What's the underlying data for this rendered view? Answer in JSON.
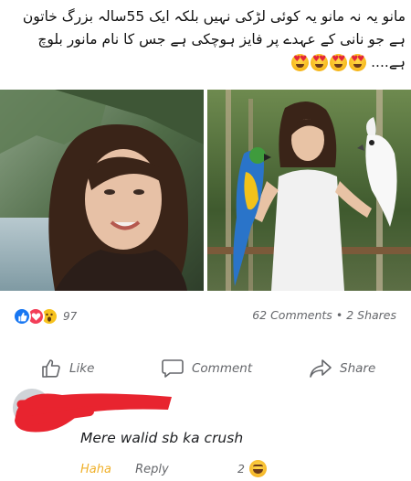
{
  "post": {
    "text_lines": [
      "مانو یہ نہ مانو یہ کوئی لڑکی نہیں بلکہ ایک 55سالہ بزرگ خاتون",
      "ہے جو نانی کے عہدے پر فایز ہوچکی ہے جس کا نام مانور بلوچ",
      "ہے...."
    ],
    "emojis": [
      "heart-eyes",
      "heart-eyes",
      "heart-eyes",
      "heart-eyes"
    ]
  },
  "reactions": {
    "types": [
      "like",
      "love",
      "wow"
    ],
    "count": "97"
  },
  "stats": {
    "comments": "62 Comments",
    "separator": "•",
    "shares": "2 Shares"
  },
  "actions": {
    "like": "Like",
    "comment": "Comment",
    "share": "Share"
  },
  "comment": {
    "text": "Mere walid sb ka crush",
    "haha": "Haha",
    "reply": "Reply",
    "reaction_count": "2",
    "reaction_type": "laugh"
  },
  "colors": {
    "facebook_blue": "#1877f2",
    "love_red": "#f33e58",
    "haha_yellow": "#f0b12c",
    "muted_gray": "#65676b",
    "redaction_red": "#e8242f"
  }
}
